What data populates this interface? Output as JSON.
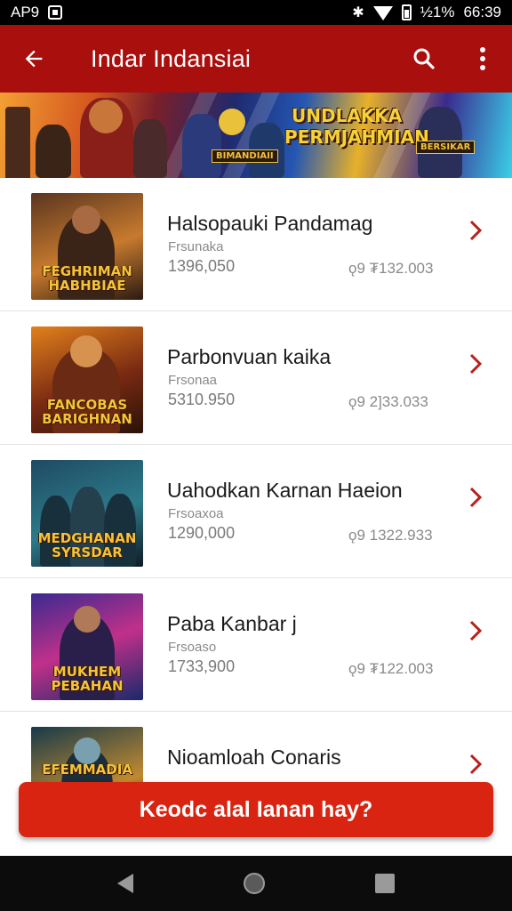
{
  "status_bar": {
    "left_text": "AP9",
    "battery_text": "½1%",
    "time": "66:39",
    "icons": [
      "square-notification-icon",
      "bluetooth-icon",
      "wifi-icon",
      "battery-icon"
    ]
  },
  "app_bar": {
    "title": "Indar Indansiai",
    "color": "#a80f0d",
    "icons": [
      "back-arrow-icon",
      "search-icon",
      "more-vert-icon"
    ]
  },
  "banner": {
    "heading_line1": "UNDLAKKA",
    "heading_line2": "PERMJAHMIAN",
    "tag_left": "BIMANDIAII",
    "tag_right": "BERSIKAR"
  },
  "games": [
    {
      "title": "Halsopauki Pandamag",
      "subtitle": "Frsunaka",
      "count": "1396,050",
      "price": "ǫ9 ₮132.003",
      "thumb_caption": "FEGHRIMAN HABHBIAE",
      "thumb_colors": [
        "#5a3520",
        "#c77a2e",
        "#2a1a12"
      ]
    },
    {
      "title": "Parbonvuan kaika",
      "subtitle": "Frsonaa",
      "count": "5310.950",
      "price": "ǫ9 2]33.033",
      "thumb_caption": "FANCOBAS BARIGHNAN",
      "thumb_colors": [
        "#e1811c",
        "#7a2a12",
        "#2a1208"
      ]
    },
    {
      "title": "Uahodkan Karnan Haeion",
      "subtitle": "Frsoaxoa",
      "count": "1290,000",
      "price": "ǫ9 1322.933",
      "thumb_caption": "MEDGHANAN SYRSDAR",
      "thumb_colors": [
        "#1f4a63",
        "#2d7a8a",
        "#0e1a24"
      ]
    },
    {
      "title": "Paba Kanbar j",
      "subtitle": "Frsoaso",
      "count": "1733,900",
      "price": "ǫ9 ₮122.003",
      "thumb_caption": "MUKHEM PEBAHAN",
      "thumb_colors": [
        "#3a2a8f",
        "#c0308a",
        "#1a2a6a"
      ]
    },
    {
      "title": "Nioamloah Conaris",
      "subtitle": "",
      "count": "",
      "price": "",
      "thumb_caption": "EFEMMADIA",
      "thumb_colors": [
        "#173a4a",
        "#c08a30",
        "#0c1820"
      ]
    }
  ],
  "cta": {
    "label": "Keodc alal Ianan hay?",
    "color": "#d82411"
  },
  "nav_bar": {
    "icons": [
      "nav-back-icon",
      "nav-home-icon",
      "nav-recents-icon"
    ]
  }
}
